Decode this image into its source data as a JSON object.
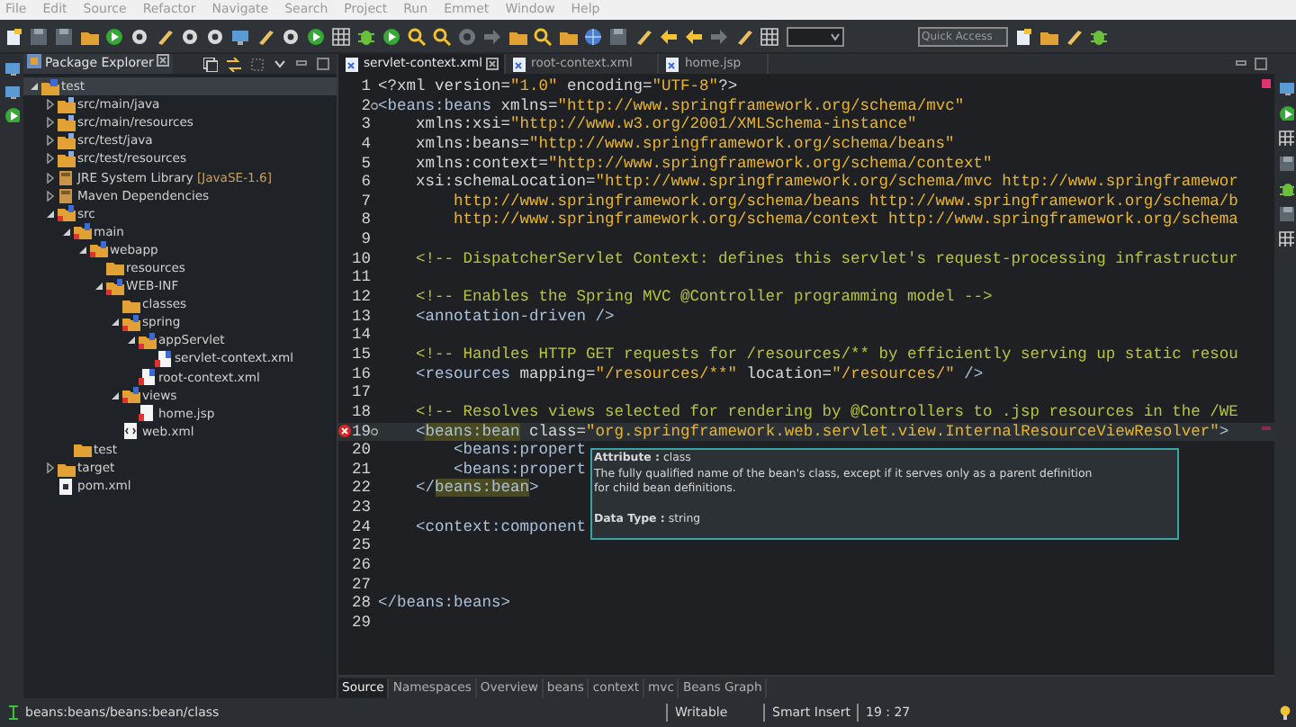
{
  "menu": [
    "File",
    "Edit",
    "Source",
    "Refactor",
    "Navigate",
    "Search",
    "Project",
    "Run",
    "Emmet",
    "Window",
    "Help"
  ],
  "toolbar": {
    "quick_access": {
      "placeholder": "Quick Access"
    }
  },
  "explorer": {
    "title": "Package Explorer",
    "tree": [
      {
        "label": "test",
        "kind": "project",
        "expanded": true,
        "selected": true,
        "children": [
          {
            "label": "src/main/java",
            "kind": "source-folder",
            "expanded": false,
            "selected": false
          },
          {
            "label": "src/main/resources",
            "kind": "source-folder",
            "expanded": false,
            "selected": false
          },
          {
            "label": "src/test/java",
            "kind": "source-folder",
            "expanded": false,
            "selected": false
          },
          {
            "label": "src/test/resources",
            "kind": "source-folder",
            "expanded": false,
            "selected": false
          },
          {
            "label": "JRE System Library",
            "decoration": "[JavaSE-1.6]",
            "kind": "library",
            "expanded": false,
            "selected": false
          },
          {
            "label": "Maven Dependencies",
            "kind": "library",
            "expanded": false,
            "selected": false
          },
          {
            "label": "src",
            "kind": "marked-folder",
            "expanded": true,
            "selected": false,
            "children": [
              {
                "label": "main",
                "kind": "marked-folder",
                "expanded": true,
                "selected": false,
                "children": [
                  {
                    "label": "webapp",
                    "kind": "marked-folder",
                    "expanded": true,
                    "selected": false,
                    "children": [
                      {
                        "label": "resources",
                        "kind": "folder",
                        "selected": false
                      },
                      {
                        "label": "WEB-INF",
                        "kind": "marked-folder",
                        "expanded": true,
                        "selected": false,
                        "children": [
                          {
                            "label": "classes",
                            "kind": "folder",
                            "selected": false
                          },
                          {
                            "label": "spring",
                            "kind": "marked-folder",
                            "expanded": true,
                            "selected": false,
                            "children": [
                              {
                                "label": "appServlet",
                                "kind": "marked-folder",
                                "expanded": true,
                                "selected": false,
                                "children": [
                                  {
                                    "label": "servlet-context.xml",
                                    "kind": "xml-file",
                                    "selected": false
                                  }
                                ]
                              },
                              {
                                "label": "root-context.xml",
                                "kind": "xml-file",
                                "selected": false
                              }
                            ]
                          },
                          {
                            "label": "views",
                            "kind": "marked-folder",
                            "expanded": true,
                            "selected": false,
                            "children": [
                              {
                                "label": "home.jsp",
                                "kind": "jsp-file",
                                "selected": false
                              }
                            ]
                          },
                          {
                            "label": "web.xml",
                            "kind": "web-xml",
                            "selected": false
                          }
                        ]
                      }
                    ]
                  }
                ]
              },
              {
                "label": "test",
                "kind": "folder",
                "selected": false
              }
            ]
          },
          {
            "label": "target",
            "kind": "folder",
            "expanded": false,
            "selected": false
          },
          {
            "label": "pom.xml",
            "kind": "pom-file",
            "selected": false
          }
        ]
      }
    ]
  },
  "editor": {
    "tabs": [
      {
        "label": "servlet-context.xml",
        "selected": true
      },
      {
        "label": "root-context.xml",
        "selected": false
      },
      {
        "label": "home.jsp",
        "selected": false
      }
    ],
    "lines": [
      {
        "number": "1",
        "fold": false,
        "error": false,
        "current": false,
        "segments": [
          {
            "kind": "plain",
            "text": "<?xml version="
          },
          {
            "kind": "string",
            "text": "\"1.0\""
          },
          {
            "kind": "plain",
            "text": " encoding="
          },
          {
            "kind": "string",
            "text": "\"UTF-8\""
          },
          {
            "kind": "plain",
            "text": "?>"
          }
        ]
      },
      {
        "number": "2",
        "fold": true,
        "error": false,
        "current": false,
        "segments": [
          {
            "kind": "tag",
            "text": "<beans:beans"
          },
          {
            "kind": "plain",
            "text": " xmlns="
          },
          {
            "kind": "string",
            "text": "\"http://www.springframework.org/schema/mvc\""
          }
        ]
      },
      {
        "number": "3",
        "fold": false,
        "error": false,
        "current": false,
        "segments": [
          {
            "kind": "plain",
            "text": "    xmlns:xsi="
          },
          {
            "kind": "string",
            "text": "\"http://www.w3.org/2001/XMLSchema-instance\""
          }
        ]
      },
      {
        "number": "4",
        "fold": false,
        "error": false,
        "current": false,
        "segments": [
          {
            "kind": "plain",
            "text": "    xmlns:beans="
          },
          {
            "kind": "string",
            "text": "\"http://www.springframework.org/schema/beans\""
          }
        ]
      },
      {
        "number": "5",
        "fold": false,
        "error": false,
        "current": false,
        "segments": [
          {
            "kind": "plain",
            "text": "    xmlns:context="
          },
          {
            "kind": "string",
            "text": "\"http://www.springframework.org/schema/context\""
          }
        ]
      },
      {
        "number": "6",
        "fold": false,
        "error": false,
        "current": false,
        "segments": [
          {
            "kind": "plain",
            "text": "    xsi:schemaLocation="
          },
          {
            "kind": "string",
            "text": "\"http://www.springframework.org/schema/mvc http://www.springframewor"
          }
        ]
      },
      {
        "number": "7",
        "fold": false,
        "error": false,
        "current": false,
        "segments": [
          {
            "kind": "string",
            "text": "        http://www.springframework.org/schema/beans http://www.springframework.org/schema/b"
          }
        ]
      },
      {
        "number": "8",
        "fold": false,
        "error": false,
        "current": false,
        "segments": [
          {
            "kind": "string",
            "text": "        http://www.springframework.org/schema/context http://www.springframework.org/schema"
          }
        ]
      },
      {
        "number": "9",
        "fold": false,
        "error": false,
        "current": false
      },
      {
        "number": "10",
        "fold": false,
        "error": false,
        "current": false,
        "segments": [
          {
            "kind": "comment",
            "text": "    <!-- DispatcherServlet Context: defines this servlet's request-processing infrastructur"
          }
        ]
      },
      {
        "number": "11",
        "fold": false,
        "error": false,
        "current": false
      },
      {
        "number": "12",
        "fold": false,
        "error": false,
        "current": false,
        "segments": [
          {
            "kind": "comment",
            "text": "    <!-- Enables the Spring MVC @Controller programming model -->"
          }
        ]
      },
      {
        "number": "13",
        "fold": false,
        "error": false,
        "current": false,
        "segments": [
          {
            "kind": "tag",
            "text": "    <annotation-driven />"
          }
        ]
      },
      {
        "number": "14",
        "fold": false,
        "error": false,
        "current": false
      },
      {
        "number": "15",
        "fold": false,
        "error": false,
        "current": false,
        "segments": [
          {
            "kind": "comment",
            "text": "    <!-- Handles HTTP GET requests for /resources/** by efficiently serving up static resou"
          }
        ]
      },
      {
        "number": "16",
        "fold": false,
        "error": false,
        "current": false,
        "segments": [
          {
            "kind": "tag",
            "text": "    <resources"
          },
          {
            "kind": "plain",
            "text": " mapping="
          },
          {
            "kind": "string",
            "text": "\"/resources/**\""
          },
          {
            "kind": "plain",
            "text": " location="
          },
          {
            "kind": "string",
            "text": "\"/resources/\""
          },
          {
            "kind": "tag",
            "text": " />"
          }
        ]
      },
      {
        "number": "17",
        "fold": false,
        "error": false,
        "current": false
      },
      {
        "number": "18",
        "fold": false,
        "error": false,
        "current": false,
        "segments": [
          {
            "kind": "comment",
            "text": "    <!-- Resolves views selected for rendering by @Controllers to .jsp resources in the /WE"
          }
        ]
      },
      {
        "number": "19",
        "fold": true,
        "error": true,
        "current": true,
        "segments": [
          {
            "kind": "tag",
            "text": "    <"
          },
          {
            "kind": "match",
            "text": "beans:bean"
          },
          {
            "kind": "plain",
            "text": " class="
          },
          {
            "kind": "string",
            "text": "\"org.springframework.web.servlet.view.InternalResourceViewResolver\""
          },
          {
            "kind": "tag",
            "text": ">"
          }
        ]
      },
      {
        "number": "20",
        "fold": false,
        "error": false,
        "current": false,
        "segments": [
          {
            "kind": "tag",
            "text": "        <beans:propert"
          }
        ]
      },
      {
        "number": "21",
        "fold": false,
        "error": false,
        "current": false,
        "segments": [
          {
            "kind": "tag",
            "text": "        <beans:propert"
          }
        ]
      },
      {
        "number": "22",
        "fold": false,
        "error": false,
        "current": false,
        "segments": [
          {
            "kind": "tag",
            "text": "    </"
          },
          {
            "kind": "match",
            "text": "beans:bean"
          },
          {
            "kind": "tag",
            "text": ">"
          }
        ]
      },
      {
        "number": "23",
        "fold": false,
        "error": false,
        "current": false
      },
      {
        "number": "24",
        "fold": false,
        "error": false,
        "current": false,
        "segments": [
          {
            "kind": "tag",
            "text": "    <context:component"
          }
        ]
      },
      {
        "number": "25",
        "fold": false,
        "error": false,
        "current": false
      },
      {
        "number": "26",
        "fold": false,
        "error": false,
        "current": false
      },
      {
        "number": "27",
        "fold": false,
        "error": false,
        "current": false
      },
      {
        "number": "28",
        "fold": false,
        "error": false,
        "current": false,
        "segments": [
          {
            "kind": "tag",
            "text": "</beans:beans>"
          }
        ]
      },
      {
        "number": "29",
        "fold": false,
        "error": false,
        "current": false
      }
    ],
    "tooltip": {
      "heading": "**Attribute :** class",
      "description": "The fully qualified name of the bean's class, except if it serves only as a parent definition for child bean definitions.",
      "data_type": "**Data Type :** string"
    },
    "bottom_tabs": [
      {
        "label": "Source",
        "selected": true
      },
      {
        "label": "Namespaces",
        "selected": false
      },
      {
        "label": "Overview",
        "selected": false
      },
      {
        "label": "beans",
        "selected": false
      },
      {
        "label": "context",
        "selected": false
      },
      {
        "label": "mvc",
        "selected": false
      },
      {
        "label": "Beans Graph",
        "selected": false
      }
    ]
  },
  "status_bar": {
    "path": "beans:beans/beans:bean/class",
    "writable": "Writable",
    "insert_mode": "Smart Insert",
    "position": "19 : 27"
  }
}
